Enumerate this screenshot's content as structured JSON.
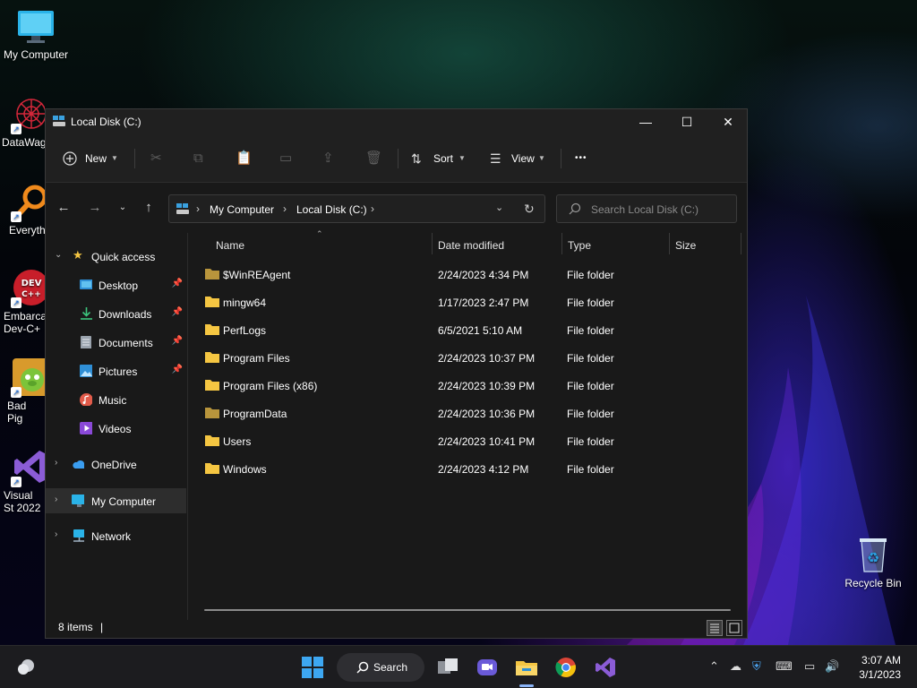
{
  "desktop": {
    "icons": [
      {
        "label": "My Computer"
      },
      {
        "label": "DataWag"
      },
      {
        "label": "Everyth"
      },
      {
        "label": "Embarca Dev-C+"
      },
      {
        "label": "Bad Pig"
      },
      {
        "label": "Visual St 2022"
      },
      {
        "label": "Recycle Bin"
      }
    ]
  },
  "window": {
    "title": "Local Disk (C:)",
    "controls": {
      "minimize": "—",
      "maximize": "☐",
      "close": "✕"
    },
    "toolbar": {
      "new_label": "New",
      "sort_label": "Sort",
      "view_label": "View",
      "more_label": "•••"
    },
    "address": {
      "crumbs": [
        "My Computer",
        "Local Disk (C:)"
      ]
    },
    "search": {
      "placeholder": "Search Local Disk (C:)"
    },
    "nav": {
      "quick_access": "Quick access",
      "items": [
        {
          "label": "Desktop",
          "pinned": true
        },
        {
          "label": "Downloads",
          "pinned": true
        },
        {
          "label": "Documents",
          "pinned": true
        },
        {
          "label": "Pictures",
          "pinned": true
        },
        {
          "label": "Music",
          "pinned": false
        },
        {
          "label": "Videos",
          "pinned": false
        }
      ],
      "onedrive": "OneDrive",
      "my_computer": "My Computer",
      "network": "Network"
    },
    "columns": {
      "name": "Name",
      "date": "Date modified",
      "type": "Type",
      "size": "Size"
    },
    "files": [
      {
        "name": "$WinREAgent",
        "date": "2/24/2023 4:34 PM",
        "type": "File folder",
        "dim": true
      },
      {
        "name": "mingw64",
        "date": "1/17/2023 2:47 PM",
        "type": "File folder",
        "dim": false
      },
      {
        "name": "PerfLogs",
        "date": "6/5/2021 5:10 AM",
        "type": "File folder",
        "dim": false
      },
      {
        "name": "Program Files",
        "date": "2/24/2023 10:37 PM",
        "type": "File folder",
        "dim": false
      },
      {
        "name": "Program Files (x86)",
        "date": "2/24/2023 10:39 PM",
        "type": "File folder",
        "dim": false
      },
      {
        "name": "ProgramData",
        "date": "2/24/2023 10:36 PM",
        "type": "File folder",
        "dim": true
      },
      {
        "name": "Users",
        "date": "2/24/2023 10:41 PM",
        "type": "File folder",
        "dim": false
      },
      {
        "name": "Windows",
        "date": "2/24/2023 4:12 PM",
        "type": "File folder",
        "dim": false
      }
    ],
    "status": {
      "count": "8 items",
      "caret": "|"
    }
  },
  "taskbar": {
    "search_label": "Search",
    "clock": {
      "time": "3:07 AM",
      "date": "3/1/2023"
    }
  },
  "colors": {
    "folder": "#f4c542",
    "folder_dim": "#b8953c",
    "accent": "#4cc2ff"
  }
}
